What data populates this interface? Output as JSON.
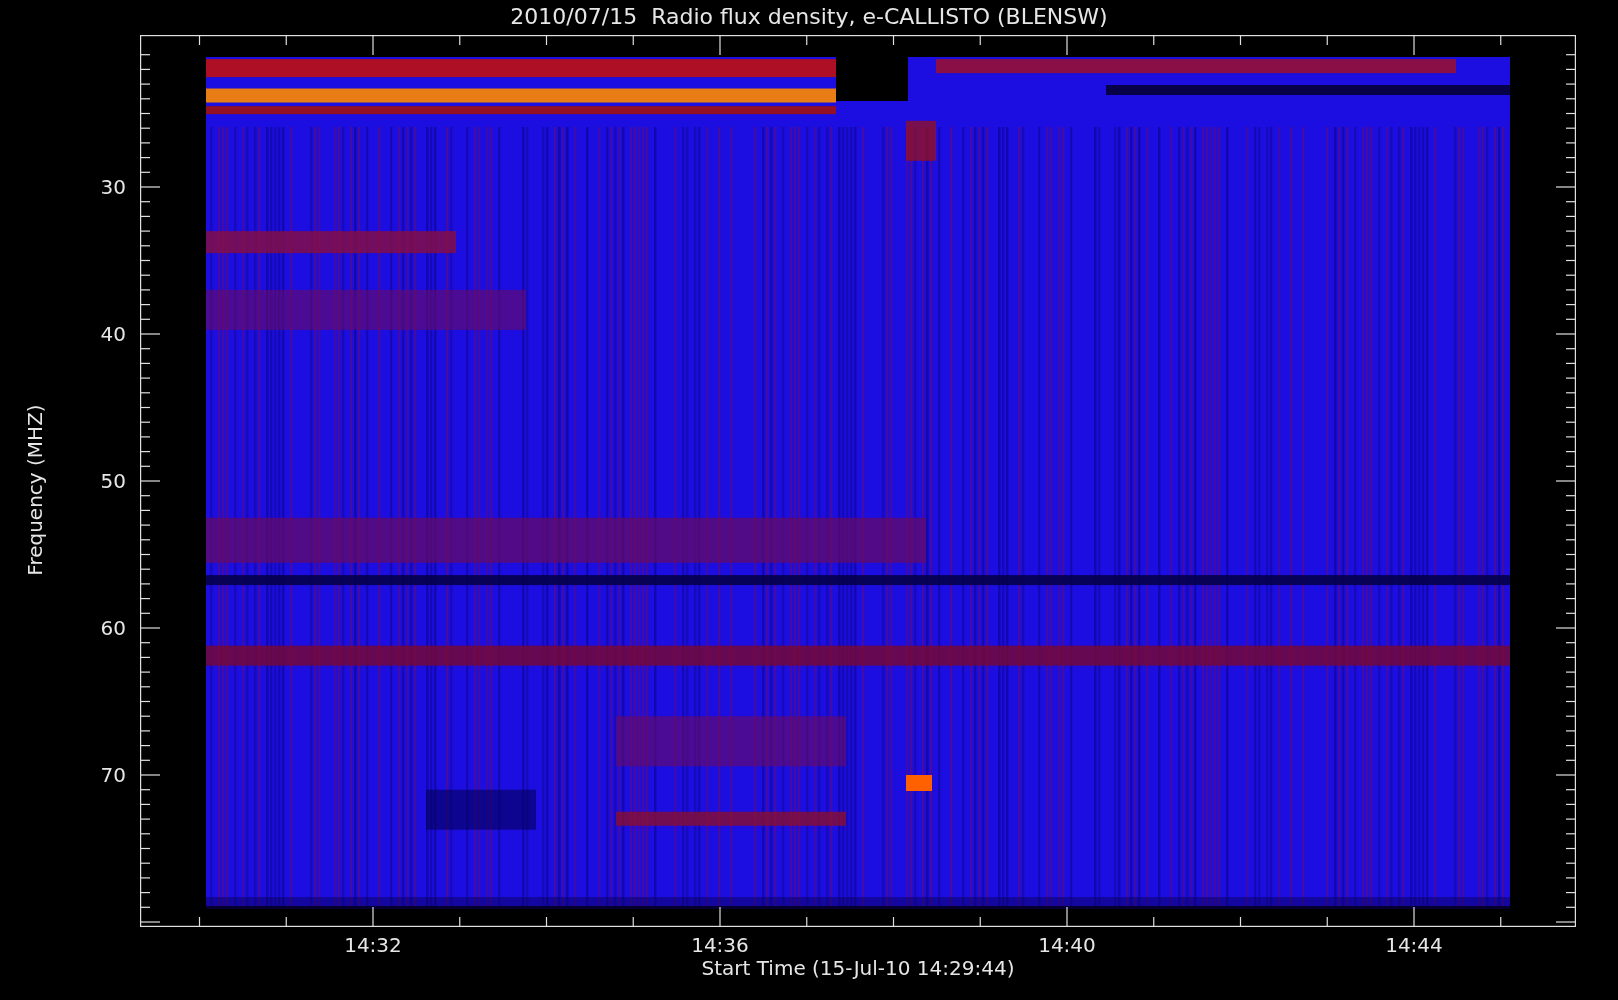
{
  "plot": {
    "title": "2010/07/15  Radio flux density, e-CALLISTO (BLENSW)",
    "y_axis": {
      "label": "Frequency (MHZ)",
      "ticks": [
        "30",
        "40",
        "50",
        "60",
        "70"
      ]
    },
    "x_axis": {
      "label": "Start Time (15-Jul-10 14:29:44)",
      "ticks": [
        "14:32",
        "14:36",
        "14:40",
        "14:44"
      ]
    }
  }
}
